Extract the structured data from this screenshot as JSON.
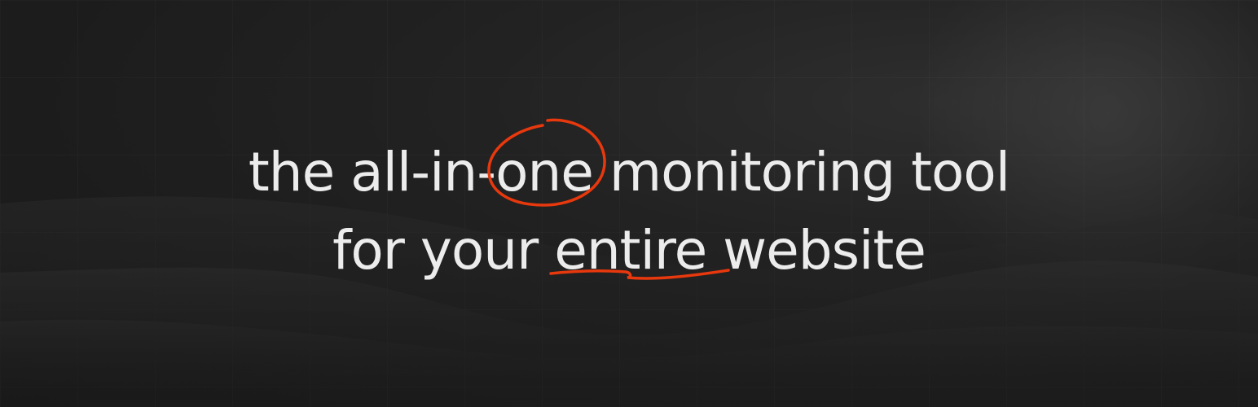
{
  "headline": {
    "line1": {
      "before": "the all-in-",
      "highlight": "one",
      "after": " monitoring tool"
    },
    "line2": {
      "before": "for your ",
      "highlight": "entire",
      "after": " website"
    }
  },
  "colors": {
    "background": "#1b1b1b",
    "text": "#ececec",
    "accent": "#e8380d"
  }
}
